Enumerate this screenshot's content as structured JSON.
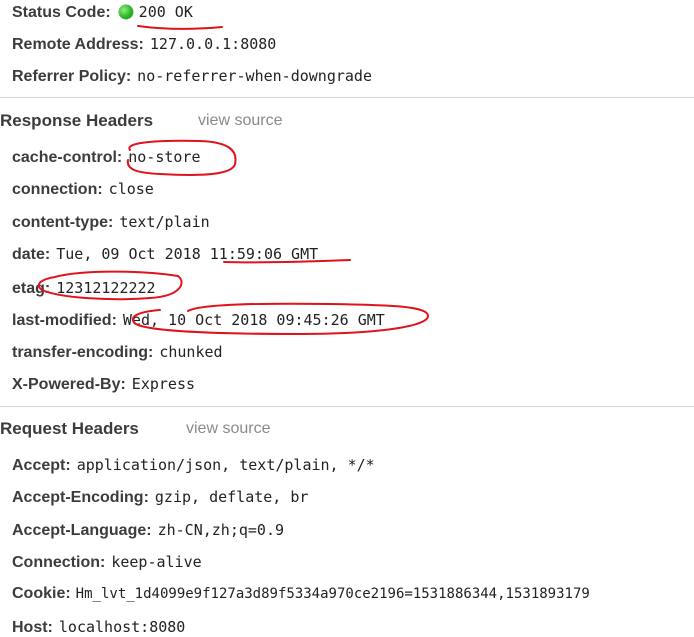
{
  "general": {
    "status_code_key": "Status Code:",
    "status_code_value": "200 OK",
    "status_color": "#2fb52a",
    "remote_address_key": "Remote Address:",
    "remote_address_value": "127.0.0.1:8080",
    "referrer_policy_key": "Referrer Policy:",
    "referrer_policy_value": "no-referrer-when-downgrade"
  },
  "response_headers": {
    "title": "Response Headers",
    "view_source": "view source",
    "items": [
      {
        "key": "cache-control:",
        "value": "no-store"
      },
      {
        "key": "connection:",
        "value": "close"
      },
      {
        "key": "content-type:",
        "value": "text/plain"
      },
      {
        "key": "date:",
        "value": "Tue, 09 Oct 2018 11:59:06 GMT"
      },
      {
        "key": "etag:",
        "value": "12312122222"
      },
      {
        "key": "last-modified:",
        "value": "Wed, 10 Oct 2018 09:45:26 GMT"
      },
      {
        "key": "transfer-encoding:",
        "value": "chunked"
      },
      {
        "key": "X-Powered-By:",
        "value": "Express"
      }
    ]
  },
  "request_headers": {
    "title": "Request Headers",
    "view_source": "view source",
    "items": [
      {
        "key": "Accept:",
        "value": "application/json, text/plain, */*"
      },
      {
        "key": "Accept-Encoding:",
        "value": "gzip, deflate, br"
      },
      {
        "key": "Accept-Language:",
        "value": "zh-CN,zh;q=0.9"
      },
      {
        "key": "Connection:",
        "value": "keep-alive"
      },
      {
        "key": "Cookie:",
        "value": "Hm_lvt_1d4099e9f127a3d89f5334a970ce2196=1531886344,1531893179"
      },
      {
        "key": "Host:",
        "value": "localhost:8080"
      }
    ]
  },
  "annotation_color": "#e0131c"
}
